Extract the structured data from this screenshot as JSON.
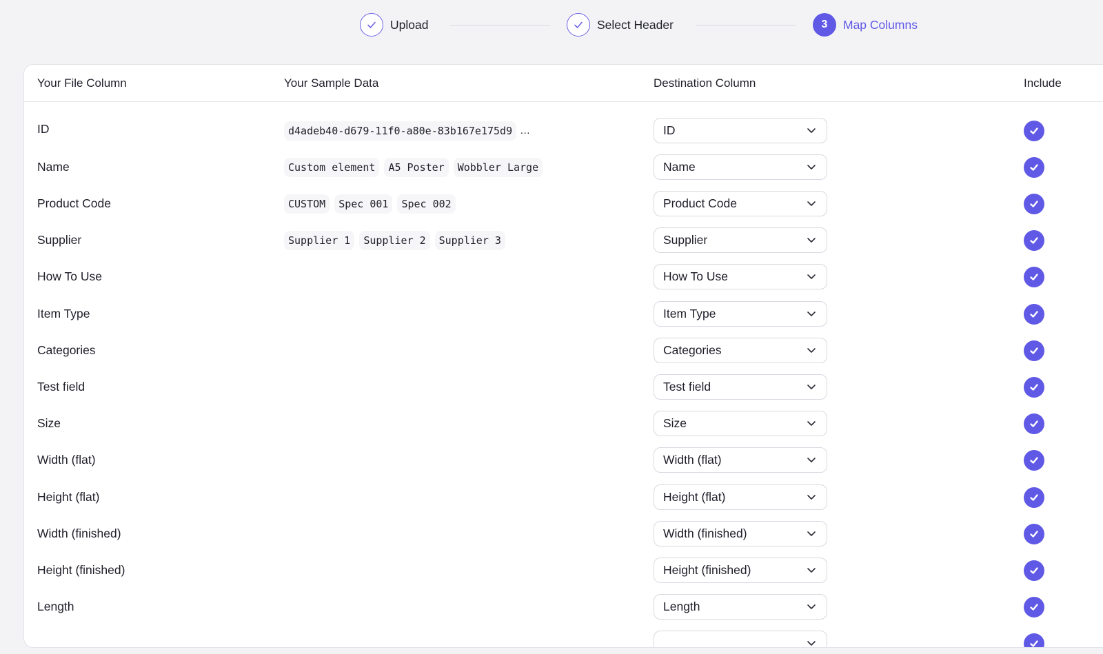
{
  "stepper": {
    "steps": [
      {
        "label": "Upload",
        "state": "done"
      },
      {
        "label": "Select Header",
        "state": "done"
      },
      {
        "label": "Map Columns",
        "state": "active",
        "number": "3"
      }
    ]
  },
  "table": {
    "headers": {
      "file_column": "Your File Column",
      "sample_data": "Your Sample Data",
      "destination": "Destination Column",
      "include": "Include"
    },
    "rows": [
      {
        "name": "ID",
        "samples": [
          "d4adeb40-d679-11f0-a80e-83b167e175d9"
        ],
        "more": "…",
        "destination": "ID",
        "include": true
      },
      {
        "name": "Name",
        "samples": [
          "Custom element",
          "A5 Poster",
          "Wobbler Large"
        ],
        "destination": "Name",
        "include": true
      },
      {
        "name": "Product Code",
        "samples": [
          "CUSTOM",
          "Spec 001",
          "Spec 002"
        ],
        "destination": "Product Code",
        "include": true
      },
      {
        "name": "Supplier",
        "samples": [
          "Supplier 1",
          "Supplier 2",
          "Supplier 3"
        ],
        "destination": "Supplier",
        "include": true
      },
      {
        "name": "How To Use",
        "samples": [],
        "destination": "How To Use",
        "include": true
      },
      {
        "name": "Item Type",
        "samples": [],
        "destination": "Item Type",
        "include": true
      },
      {
        "name": "Categories",
        "samples": [],
        "destination": "Categories",
        "include": true
      },
      {
        "name": "Test field",
        "samples": [],
        "destination": "Test field",
        "include": true
      },
      {
        "name": "Size",
        "samples": [],
        "destination": "Size",
        "include": true
      },
      {
        "name": "Width (flat)",
        "samples": [],
        "destination": "Width (flat)",
        "include": true
      },
      {
        "name": "Height (flat)",
        "samples": [],
        "destination": "Height (flat)",
        "include": true
      },
      {
        "name": "Width (finished)",
        "samples": [],
        "destination": "Width (finished)",
        "include": true
      },
      {
        "name": "Height (finished)",
        "samples": [],
        "destination": "Height (finished)",
        "include": true
      },
      {
        "name": "Length",
        "samples": [],
        "destination": "Length",
        "include": true
      },
      {
        "name": "",
        "samples": [],
        "destination": "",
        "include": true
      }
    ]
  },
  "colors": {
    "accent": "#6059e6",
    "background": "#f3f3f6",
    "card": "#ffffff"
  }
}
